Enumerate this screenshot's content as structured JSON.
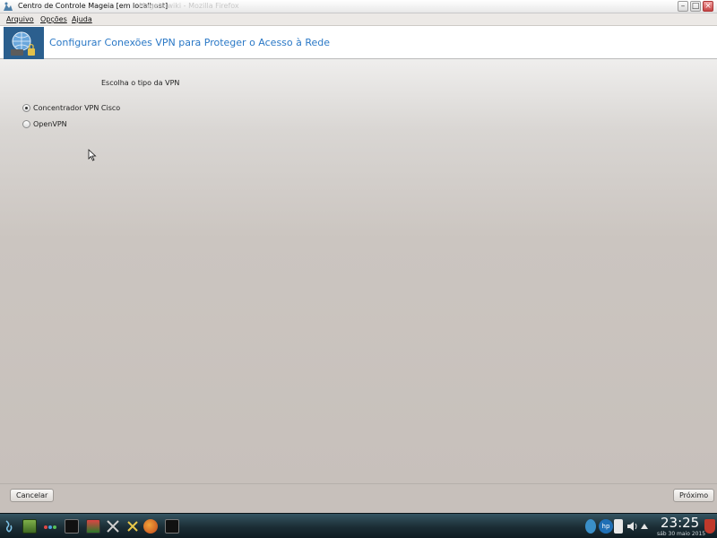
{
  "window": {
    "title": "Centro de Controle Mageia  [em localhost]",
    "background_text": "Mageia wiki - Mozilla Firefox",
    "buttons": [
      "minimize",
      "maximize",
      "close"
    ]
  },
  "menubar": {
    "items": [
      "Arquivo",
      "Opções",
      "Ajuda"
    ]
  },
  "banner": {
    "title": "Configurar Conexões VPN para Proteger o Acesso à Rede",
    "icon": "vpn-globe-lock-icon"
  },
  "content": {
    "prompt": "Escolha o tipo da VPN",
    "options": [
      {
        "label": "Concentrador VPN Cisco",
        "checked": true
      },
      {
        "label": "OpenVPN",
        "checked": false
      }
    ]
  },
  "footer": {
    "cancel_label": "Cancelar",
    "next_label": "Próximo"
  },
  "taskbar": {
    "time": "23:25",
    "date": "sáb 30 maio 2015",
    "tray_icons": [
      "network-icon",
      "hp-icon",
      "clipboard-icon",
      "volume-icon",
      "expand-tray-icon",
      "shield-icon"
    ],
    "launchers": [
      "mageia-menu-icon",
      "desktop-grid-icon",
      "color-dots-icon",
      "terminal-icon",
      "book-icon",
      "tools-icon",
      "tools2-icon",
      "firefox-icon",
      "terminal2-icon"
    ]
  },
  "colors": {
    "accent_title": "#2a78c6",
    "banner_icon_bg": "#2b5f8e",
    "taskbar": "#1b2d35"
  }
}
